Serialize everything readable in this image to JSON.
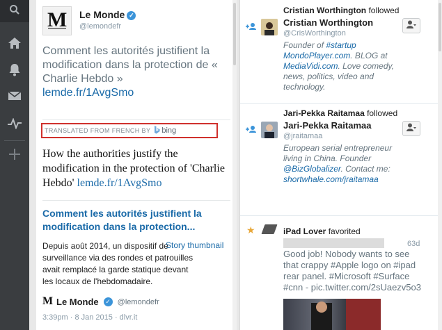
{
  "rail": {
    "icons": [
      "search-icon",
      "home-icon",
      "notifications-icon",
      "messages-icon",
      "activity-icon",
      "add-column-icon"
    ]
  },
  "tweet": {
    "author_name": "Le Monde",
    "author_handle": "@lemondefr",
    "text": "Comment les autorités justifient la modification dans la protection de « Charlie Hebdo »",
    "link": "lemde.fr/1AvgSmo",
    "translated_label": "TRANSLATED FROM FRENCH BY",
    "translator": "bing",
    "translation_text": "How the authorities justify the modification in the protection of 'Charlie Hebdo'",
    "translation_link": "lemde.fr/1AvgSmo",
    "card_title": "Comment les autorités justifient la modification dans la protection...",
    "card_body": "Depuis août 2014, un dispositif de surveillance via des rondes et patrouilles avait remplacé la garde statique devant les locaux de l'hebdomadaire.",
    "thumbnail_label": "Story thumbnail",
    "card_source_name": "Le Monde",
    "card_source_handle": "@lemondefr",
    "meta": "3:39pm · 8 Jan 2015 · dlvr.it"
  },
  "activity": {
    "items": [
      {
        "title_name": "Cristian Worthington",
        "title_action": " followed",
        "name": "Cristian Worthington",
        "handle": "@CrisWorthington",
        "bio": "Founder of #startup MondoPlayer.com. BLOG at MediaVidi.com. Love comedy, news, politics, video and technology."
      },
      {
        "title_name": "Jari-Pekka Raitamaa",
        "title_action": " followed",
        "name": "Jari-Pekka Raitamaa",
        "handle": "@jraitamaa",
        "bio": "European serial entrepreneur living in China. Founder @BizGlobalizer. Contact me: shortwhale.com/jraitamaa"
      }
    ],
    "favorite": {
      "title_name": "iPad Lover",
      "title_action": " favorited",
      "age": "63d",
      "text": "Good job! Nobody wants to see that crappy #Apple logo on #ipad rear panel. #Microsoft #Surface #cnn - pic.twitter.com/2sUaezv5o3"
    }
  },
  "colors": {
    "link": "#1a6aa8",
    "rail": "#3a3d40",
    "highlight_border": "#d0312d",
    "follow_icon": "#3b94d9"
  }
}
